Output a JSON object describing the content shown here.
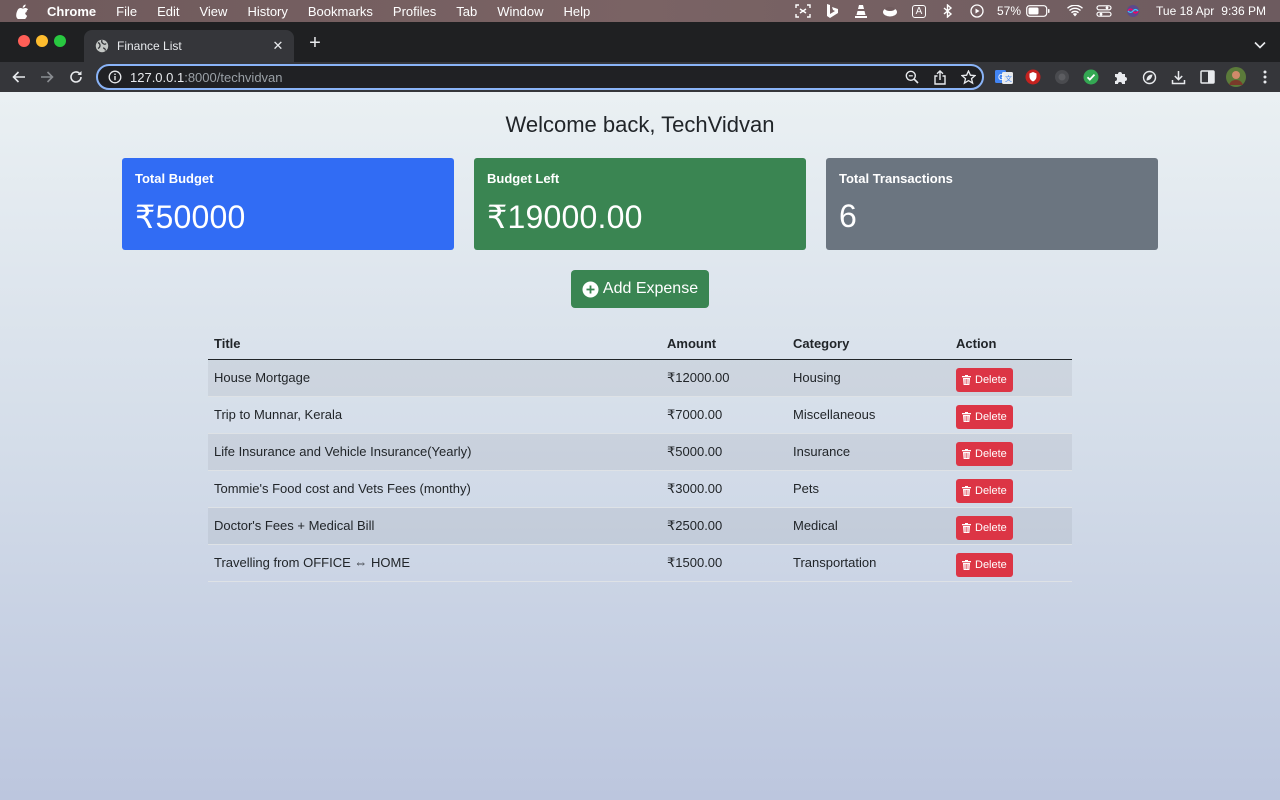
{
  "menubar": {
    "app": "Chrome",
    "items": [
      "File",
      "Edit",
      "View",
      "History",
      "Bookmarks",
      "Profiles",
      "Tab",
      "Window",
      "Help"
    ],
    "battery": "57%",
    "date": "Tue 18 Apr",
    "time": "9:36 PM",
    "input_icon_label": "A"
  },
  "tab": {
    "title": "Finance List"
  },
  "toolbar": {
    "url_host": "127.0.0.1",
    "url_path": ":8000/techvidvan"
  },
  "page": {
    "welcome": "Welcome back, TechVidvan",
    "cards": {
      "budget_label": "Total Budget",
      "budget_value": "₹50000",
      "left_label": "Budget Left",
      "left_value": "₹19000.00",
      "tx_label": "Total Transactions",
      "tx_value": "6"
    },
    "add_button": "Add Expense",
    "table": {
      "headers": {
        "title": "Title",
        "amount": "Amount",
        "category": "Category",
        "action": "Action"
      },
      "rows": [
        {
          "title": "House Mortgage",
          "amount": "₹12000.00",
          "category": "Housing",
          "action": "Delete"
        },
        {
          "title": "Trip to Munnar, Kerala",
          "amount": "₹7000.00",
          "category": "Miscellaneous",
          "action": "Delete"
        },
        {
          "title": "Life Insurance and Vehicle Insurance(Yearly)",
          "amount": "₹5000.00",
          "category": "Insurance",
          "action": "Delete"
        },
        {
          "title": "Tommie's Food cost and Vets Fees (monthy)",
          "amount": "₹3000.00",
          "category": "Pets",
          "action": "Delete"
        },
        {
          "title": "Doctor's Fees + Medical Bill",
          "amount": "₹2500.00",
          "category": "Medical",
          "action": "Delete"
        },
        {
          "title": "Travelling from OFFICE ⇔ HOME",
          "amount": "₹1500.00",
          "category": "Transportation",
          "action": "Delete"
        }
      ]
    }
  },
  "colors": {
    "primary": "#316cf4",
    "success": "#3a8552",
    "secondary": "#6b7580",
    "danger": "#dc3545"
  }
}
